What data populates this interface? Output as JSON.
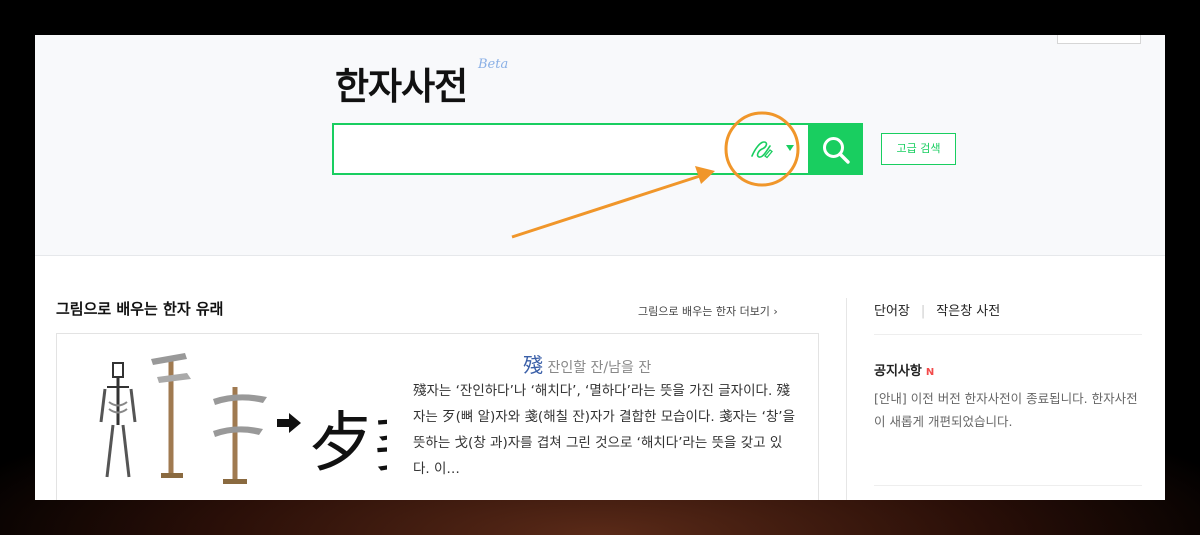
{
  "logo": {
    "title": "한자사전",
    "badge": "Beta"
  },
  "search": {
    "value": "",
    "placeholder": ""
  },
  "advanced_search_label": "고급 검색",
  "section": {
    "title": "그림으로 배우는 한자 유래",
    "more_link": "그림으로 배우는 한자 더보기 ›"
  },
  "card": {
    "character": "殘",
    "meaning": "잔인할 잔/남을 잔",
    "description": "殘자는 ‘잔인하다’나 ‘해치다’, ‘멸하다’라는 뜻을 가진 글자이다. 殘자는 歹(뼈 알)자와 戔(해칠 잔)자가 결합한 모습이다. 戔자는 ‘창’을 뜻하는 戈(창 과)자를 겹쳐 그린 것으로 ‘해치다’라는 뜻을 갖고 있다. 이…",
    "illustration_result_char": "歺戔"
  },
  "side": {
    "tab_vocab": "단어장",
    "tab_mini": "작은창 사전",
    "notice_title": "공지사항",
    "notice_badge": "N",
    "notice_text": "[안내] 이전 버전 한자사전이 종료됩니다. 한자사전이 새롭게 개편되었습니다."
  },
  "icons": {
    "handwriting": "handwriting-icon",
    "dropdown": "caret-down-icon",
    "search": "search-icon",
    "annotation": "orange-arrow-and-circle"
  },
  "colors": {
    "accent": "#19ce60",
    "annotation": "#f0962a",
    "new_badge": "#f24a4a",
    "hanja": "#3a5fa8"
  }
}
